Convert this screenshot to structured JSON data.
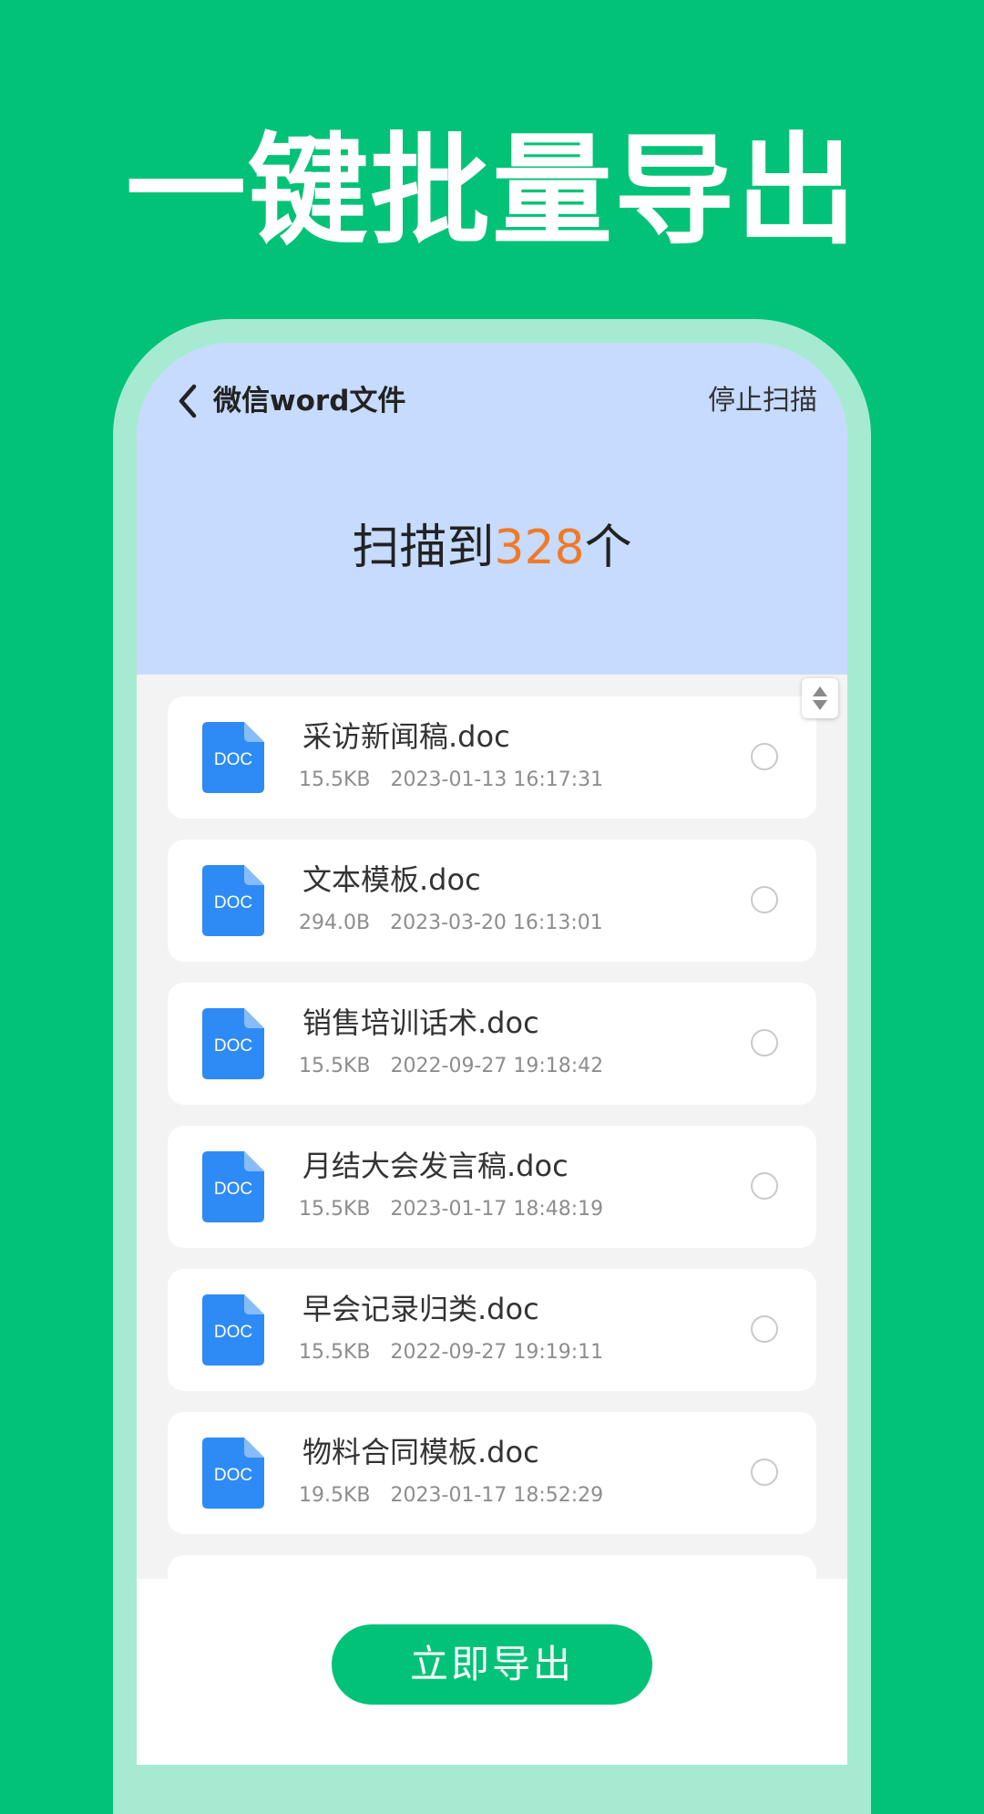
{
  "headline": "一键批量导出",
  "header": {
    "title": "微信word文件",
    "stop_label": "停止扫描"
  },
  "scan": {
    "prefix": "扫描到",
    "count": "328",
    "suffix": "个"
  },
  "files": [
    {
      "name": "采访新闻稿.doc",
      "size": "15.5KB",
      "date": "2023-01-13 16:17:31",
      "icon_label": "DOC"
    },
    {
      "name": "文本模板.doc",
      "size": "294.0B",
      "date": "2023-03-20 16:13:01",
      "icon_label": "DOC"
    },
    {
      "name": "销售培训话术.doc",
      "size": "15.5KB",
      "date": "2022-09-27 19:18:42",
      "icon_label": "DOC"
    },
    {
      "name": "月结大会发言稿.doc",
      "size": "15.5KB",
      "date": "2023-01-17 18:48:19",
      "icon_label": "DOC"
    },
    {
      "name": "早会记录归类.doc",
      "size": "15.5KB",
      "date": "2022-09-27 19:19:11",
      "icon_label": "DOC"
    },
    {
      "name": "物料合同模板.doc",
      "size": "19.5KB",
      "date": "2023-01-17 18:52:29",
      "icon_label": "DOC"
    }
  ],
  "export_label": "立即导出",
  "colors": {
    "brand_green": "#02C277",
    "header_blue": "#C6DBFD",
    "count_orange": "#F07A28",
    "doc_blue": "#2E8BF5"
  },
  "icons": {
    "back": "chevron-left-icon",
    "doc": "doc-file-icon",
    "scroll": "scroll-handle-icon"
  }
}
